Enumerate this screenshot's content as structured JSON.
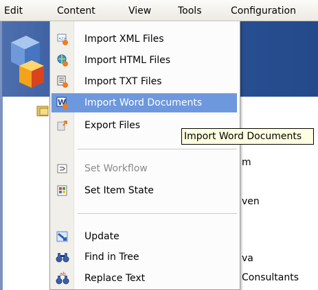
{
  "menubar": {
    "items": [
      "Edit",
      "Content",
      "View",
      "Tools",
      "Configuration"
    ]
  },
  "menu": {
    "items": [
      {
        "label": "Import XML Files",
        "icon": "import-xml-icon",
        "state": "normal"
      },
      {
        "label": "Import HTML Files",
        "icon": "import-html-icon",
        "state": "normal"
      },
      {
        "label": "Import TXT Files",
        "icon": "import-txt-icon",
        "state": "normal"
      },
      {
        "label": "Import Word Documents",
        "icon": "import-word-icon",
        "state": "highlighted"
      },
      {
        "label": "Export Files",
        "icon": "export-files-icon",
        "state": "normal"
      },
      {
        "label": "Set Workflow",
        "icon": "workflow-icon",
        "state": "disabled"
      },
      {
        "label": "Set Item State",
        "icon": "item-state-icon",
        "state": "normal"
      },
      {
        "label": "Update",
        "icon": "update-icon",
        "state": "normal"
      },
      {
        "label": "Find in Tree",
        "icon": "binoculars-icon",
        "state": "normal"
      },
      {
        "label": "Replace Text",
        "icon": "replace-text-icon",
        "state": "normal"
      }
    ],
    "highlight_color": "#6d98de"
  },
  "tooltip": {
    "text": "Import Word Documents"
  },
  "background": {
    "texts": [
      "m",
      "ven",
      "va",
      "Consultants"
    ],
    "band_color": "#2e5597"
  }
}
